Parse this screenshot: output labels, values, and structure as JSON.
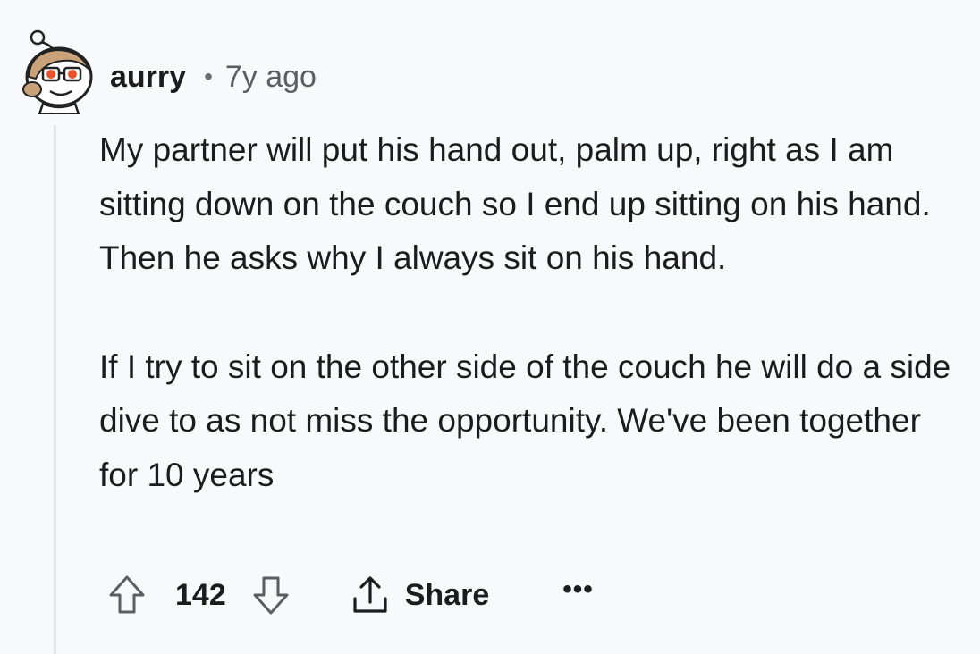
{
  "comment": {
    "username": "aurry",
    "separator": "•",
    "timestamp": "7y ago",
    "paragraphs": [
      "My partner will put his hand out, palm up, right as I am sitting down on the couch so I end up sitting on his hand. Then he asks why I always sit on his hand.",
      "If I try to sit on the other side of the couch he will do a side dive to as not miss the opportunity. We've been together for 10 years"
    ]
  },
  "actions": {
    "upvote_icon": "arrow-up-outline-icon",
    "score": "142",
    "downvote_icon": "arrow-down-outline-icon",
    "share_icon": "share-upload-icon",
    "share_label": "Share",
    "more_label": "•••"
  },
  "colors": {
    "background": "#f8f9fb",
    "text": "#1c1c1c",
    "muted": "#5a5e62",
    "thread_line": "#dfe3e6"
  }
}
